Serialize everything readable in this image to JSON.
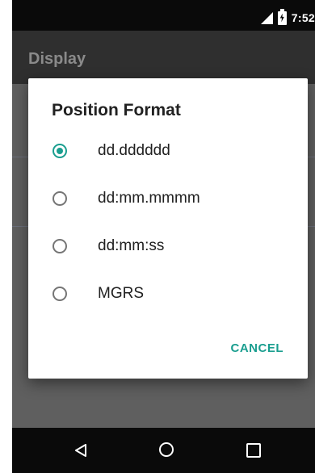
{
  "status_bar": {
    "time": "7:52",
    "icons": [
      "signal-icon",
      "battery-charging-icon"
    ]
  },
  "app_bar": {
    "title": "Display"
  },
  "dialog": {
    "title": "Position Format",
    "options": [
      {
        "label": "dd.dddddd",
        "selected": true
      },
      {
        "label": "dd:mm.mmmm",
        "selected": false
      },
      {
        "label": "dd:mm:ss",
        "selected": false
      },
      {
        "label": "MGRS",
        "selected": false
      }
    ],
    "cancel_label": "CANCEL"
  },
  "nav_bar": {
    "icons": [
      "back-icon",
      "home-icon",
      "recent-apps-icon"
    ]
  },
  "colors": {
    "accent": "#1a9e8f",
    "status_bar": "#0a0a0a",
    "app_bar": "#2f2f2f",
    "scrim": "#5f5f5f"
  }
}
